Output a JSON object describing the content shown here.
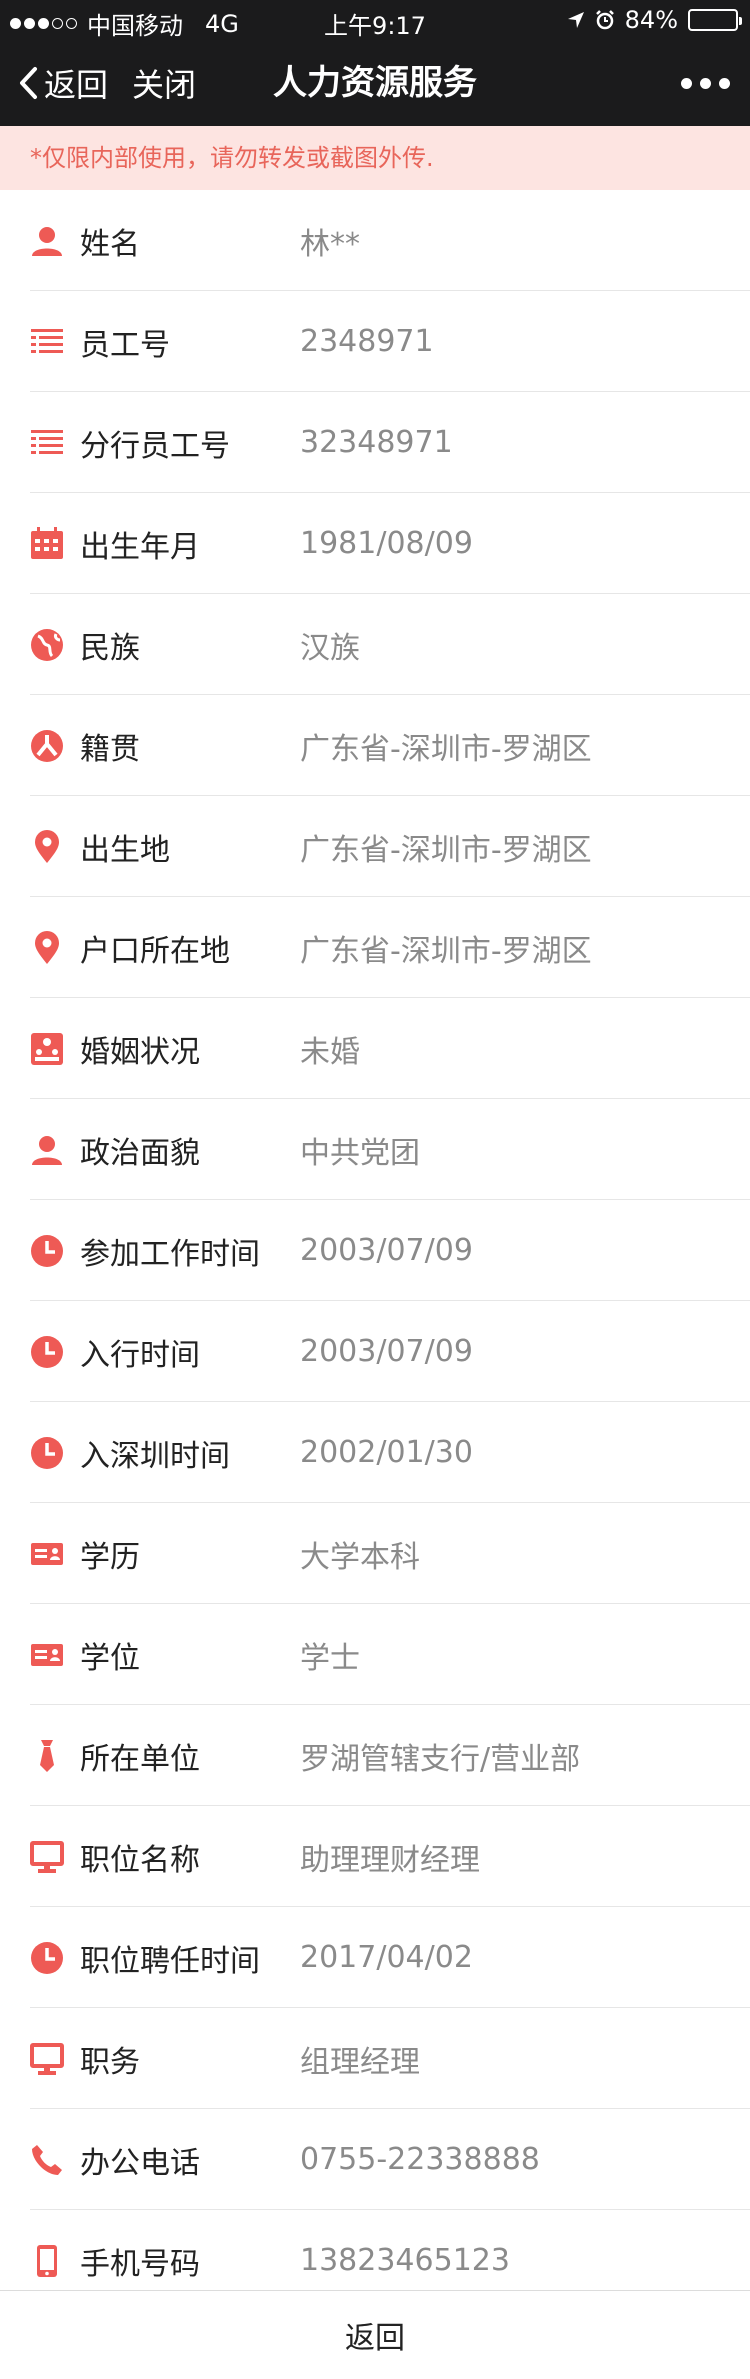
{
  "status_bar": {
    "carrier": "中国移动",
    "network": "4G",
    "time": "上午9:17",
    "battery": "84%",
    "battery_level": 0.84
  },
  "nav": {
    "back_label": "返回",
    "close_label": "关闭",
    "title": "人力资源服务"
  },
  "notice": "*仅限内部使用，请勿转发或截图外传.",
  "accent_color": "#ee5a55",
  "rows": [
    {
      "icon": "person-icon",
      "label": "姓名",
      "value": "林**"
    },
    {
      "icon": "id-list-icon",
      "label": "员工号",
      "value": "2348971"
    },
    {
      "icon": "id-list-icon",
      "label": "分行员工号",
      "value": "32348971"
    },
    {
      "icon": "calendar-icon",
      "label": "出生年月",
      "value": "1981/08/09"
    },
    {
      "icon": "globe-icon",
      "label": "民族",
      "value": "汉族"
    },
    {
      "icon": "ancestry-icon",
      "label": "籍贯",
      "value": "广东省-深圳市-罗湖区"
    },
    {
      "icon": "location-pin-icon",
      "label": "出生地",
      "value": "广东省-深圳市-罗湖区"
    },
    {
      "icon": "location-pin-icon",
      "label": "户口所在地",
      "value": "广东省-深圳市-罗湖区"
    },
    {
      "icon": "marriage-icon",
      "label": "婚姻状况",
      "value": "未婚"
    },
    {
      "icon": "person-icon",
      "label": "政治面貌",
      "value": "中共党团"
    },
    {
      "icon": "clock-icon",
      "label": "参加工作时间",
      "value": "2003/07/09"
    },
    {
      "icon": "clock-icon",
      "label": "入行时间",
      "value": "2003/07/09"
    },
    {
      "icon": "clock-icon",
      "label": "入深圳时间",
      "value": "2002/01/30"
    },
    {
      "icon": "id-card-icon",
      "label": "学历",
      "value": "大学本科"
    },
    {
      "icon": "id-card-icon",
      "label": "学位",
      "value": "学士"
    },
    {
      "icon": "tie-icon",
      "label": "所在单位",
      "value": "罗湖管辖支行/营业部"
    },
    {
      "icon": "monitor-icon",
      "label": "职位名称",
      "value": "助理理财经理"
    },
    {
      "icon": "clock-icon",
      "label": "职位聘任时间",
      "value": "2017/04/02"
    },
    {
      "icon": "monitor-icon",
      "label": "职务",
      "value": "组理经理"
    },
    {
      "icon": "phone-icon",
      "label": "办公电话",
      "value": "0755-22338888"
    },
    {
      "icon": "mobile-phone-icon",
      "label": "手机号码",
      "value": "13823465123"
    }
  ],
  "footer": {
    "back_label": "返回"
  }
}
